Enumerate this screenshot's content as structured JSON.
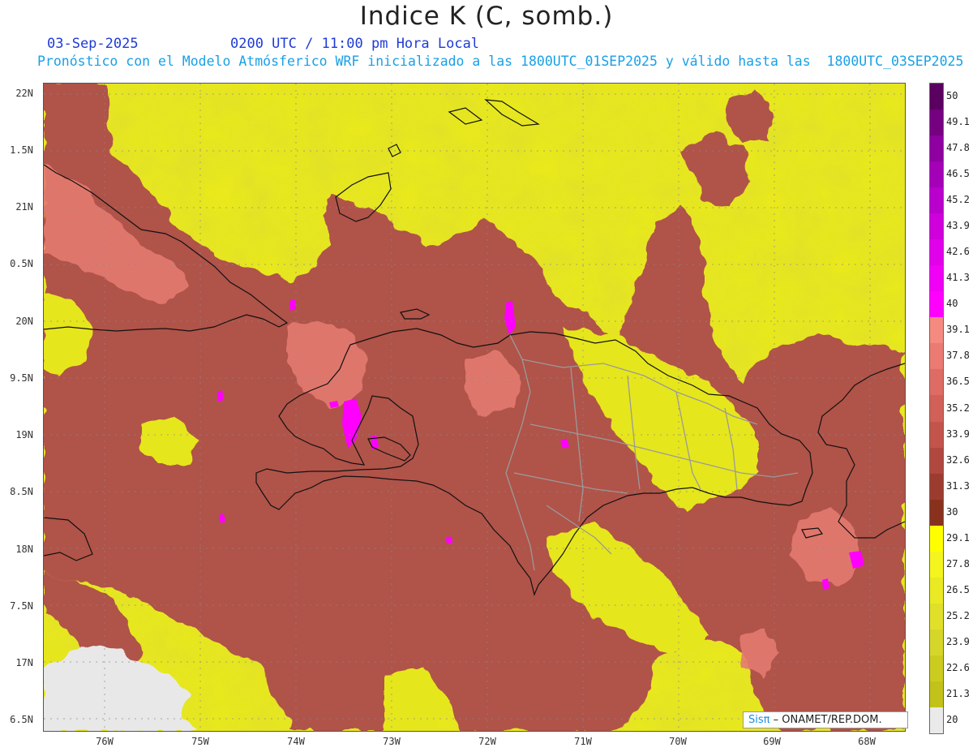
{
  "title": "Indice K (C, somb.)",
  "date": "03-Sep-2025",
  "time_label": "0200 UTC / 11:00 pm Hora Local",
  "forecast_note": "Pronóstico con el Modelo Atmósferico WRF inicializado a las 1800UTC_01SEP2025 y válido hasta las  1800UTC_03SEP2025",
  "credit": {
    "prefix": "Sisπ",
    "text": "– ONAMET/REP.DOM."
  },
  "lat_labels": [
    "22N",
    "1.5N",
    "21N",
    "0.5N",
    "20N",
    "9.5N",
    "19N",
    "8.5N",
    "18N",
    "7.5N",
    "17N",
    "6.5N"
  ],
  "lon_labels": [
    "76W",
    "75W",
    "74W",
    "73W",
    "72W",
    "71W",
    "70W",
    "69W",
    "68W"
  ],
  "colorbar": {
    "labels": [
      "50",
      "49.1",
      "47.8",
      "46.5",
      "45.2",
      "43.9",
      "42.6",
      "41.3",
      "40",
      "39.1",
      "37.8",
      "36.5",
      "35.2",
      "33.9",
      "32.6",
      "31.3",
      "30",
      "29.1",
      "27.8",
      "26.5",
      "25.2",
      "23.9",
      "22.6",
      "21.3",
      "20"
    ],
    "colors": [
      "#5a0060",
      "#750080",
      "#8e00a0",
      "#a400b8",
      "#b900cc",
      "#cf00dc",
      "#e000ea",
      "#f000f5",
      "#ff00ff",
      "#f48a80",
      "#ea7a72",
      "#de6c64",
      "#d06058",
      "#c2544c",
      "#b04840",
      "#9c3c30",
      "#88321e",
      "#ffff00",
      "#f4f41e",
      "#eaea24",
      "#e0e02a",
      "#d6d62a",
      "#cccc20",
      "#c2c21a",
      "#eaeaea"
    ]
  },
  "colors": {
    "low": "#e8e81e",
    "mid": "#b5524a",
    "high": "#e97a70",
    "extreme": "#ff00ff",
    "nodata": "#e8e8e8"
  }
}
